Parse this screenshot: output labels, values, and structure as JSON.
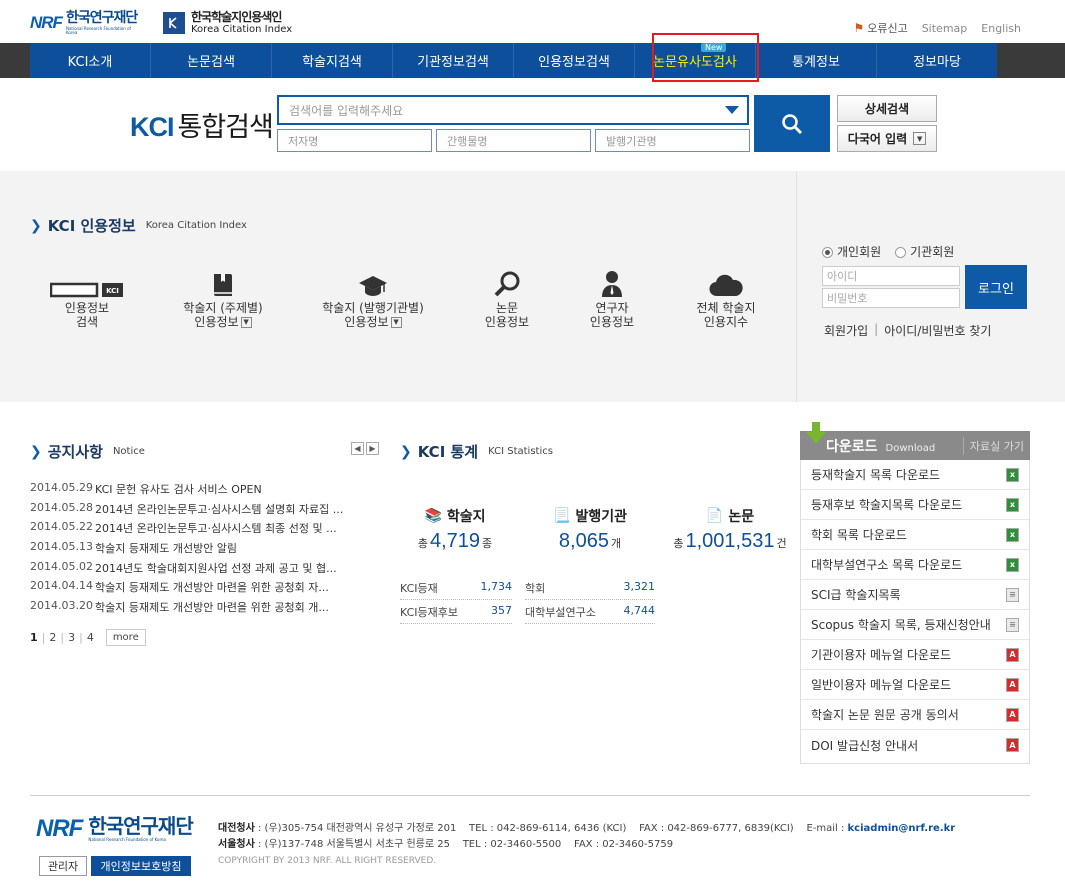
{
  "header": {
    "nrf_logo_mark": "NRF",
    "nrf_logo_kr": "한국연구재단",
    "nrf_logo_en": "National Research Foundation of Korea",
    "kci_logo_kr": "한국학술지인용색인",
    "kci_logo_en": "Korea Citation Index",
    "util": {
      "error_report": "오류신고",
      "sitemap": "Sitemap",
      "english": "English"
    }
  },
  "gnb": {
    "items": [
      "KCI소개",
      "논문검색",
      "학술지검색",
      "기관정보검색",
      "인용정보검색",
      "논문유사도검사",
      "통계정보",
      "정보마당"
    ],
    "new_badge": "New"
  },
  "search": {
    "title_bold": "KCI",
    "title": "통합검색",
    "main_placeholder": "검색어를 입력해주세요",
    "author_placeholder": "저자명",
    "journal_placeholder": "간행물명",
    "publisher_placeholder": "발행기관명",
    "detail_button": "상세검색",
    "multilang_button": "다국어 입력"
  },
  "citation": {
    "title": "KCI 인용정보",
    "subtitle": "Korea Citation Index",
    "items": [
      {
        "l1": "인용정보",
        "l2": "검색"
      },
      {
        "l1": "학술지 (주제별)",
        "l2": "인용정보"
      },
      {
        "l1": "학술지 (발행기관별)",
        "l2": "인용정보"
      },
      {
        "l1": "논문",
        "l2": "인용정보"
      },
      {
        "l1": "연구자",
        "l2": "인용정보"
      },
      {
        "l1": "전체 학술지",
        "l2": "인용지수"
      }
    ],
    "kci_tag": "KCI"
  },
  "login": {
    "radio_personal": "개인회원",
    "radio_institution": "기관회원",
    "id_placeholder": "아이디",
    "pw_placeholder": "비밀번호",
    "login_button": "로그인",
    "join": "회원가입",
    "find": "아이디/비밀번호 찾기"
  },
  "notice": {
    "title": "공지사항",
    "subtitle": "Notice",
    "rows": [
      {
        "date": "2014.05.29",
        "text": "KCI 문헌 유사도 검사 서비스 OPEN"
      },
      {
        "date": "2014.05.28",
        "text": "2014년 온라인논문투고·심사시스템 설명회 자료집 ..."
      },
      {
        "date": "2014.05.22",
        "text": "2014년 온라인논문투고·심사시스템 최종 선정 및 ..."
      },
      {
        "date": "2014.05.13",
        "text": "학술지 등재제도 개선방안 알림"
      },
      {
        "date": "2014.05.02",
        "text": "2014년도 학술대회지원사업 선정 과제 공고 및 협..."
      },
      {
        "date": "2014.04.14",
        "text": "학술지 등재제도 개선방안 마련을 위한 공청회 자..."
      },
      {
        "date": "2014.03.20",
        "text": "학술지 등재제도 개선방안 마련을 위한 공청회 개..."
      }
    ],
    "pages": [
      "1",
      "2",
      "3",
      "4"
    ],
    "more": "more"
  },
  "stats": {
    "title": "KCI 통계",
    "subtitle": "KCI Statistics",
    "journal": {
      "label": "학술지",
      "prefix": "총",
      "value": "4,719",
      "unit": "종"
    },
    "publisher": {
      "label": "발행기관",
      "value": "8,065",
      "unit": "개"
    },
    "paper": {
      "label": "논문",
      "prefix": "총",
      "value": "1,001,531",
      "unit": "건"
    },
    "rows": [
      {
        "name": "KCI등재",
        "value": "1,734"
      },
      {
        "name": "학회",
        "value": "3,321"
      },
      {
        "name": "KCI등재후보",
        "value": "357"
      },
      {
        "name": "대학부설연구소",
        "value": "4,744"
      }
    ]
  },
  "download": {
    "title": "다운로드",
    "subtitle": "Download",
    "go": "자료실 가기",
    "items": [
      {
        "label": "등재학술지 목록 다운로드",
        "icon": "xls"
      },
      {
        "label": "등재후보 학술지목록 다운로드",
        "icon": "xls"
      },
      {
        "label": "학회 목록 다운로드",
        "icon": "xls"
      },
      {
        "label": "대학부설연구소 목록 다운로드",
        "icon": "xls"
      },
      {
        "label": "SCI급 학술지목록",
        "icon": "doc"
      },
      {
        "label": "Scopus 학술지 목록, 등재신청안내",
        "icon": "doc"
      },
      {
        "label": "기관이용자 메뉴얼 다운로드",
        "icon": "pdf"
      },
      {
        "label": "일반이용자 메뉴얼 다운로드",
        "icon": "pdf"
      },
      {
        "label": "학술지 논문 원문 공개 동의서",
        "icon": "pdf"
      },
      {
        "label": "DOI 발급신청 안내서",
        "icon": "pdf"
      }
    ]
  },
  "footer": {
    "admin_button": "관리자",
    "privacy_button": "개인정보보호방침",
    "daejeon_label": "대전청사",
    "daejeon_addr": " : (우)305-754 대전광역시 유성구 가정로 201",
    "daejeon_tel": "TEL : 042-869-6114, 6436 (KCI)",
    "daejeon_fax": "FAX : 042-869-6777, 6839(KCI)",
    "email_label": "E-mail : ",
    "email": "kciadmin@nrf.re.kr",
    "seoul_label": "서울청사",
    "seoul_addr": " : (우)137-748 서울특별시 서초구 헌릉로 25",
    "seoul_tel": "TEL : 02-3460-5500",
    "seoul_fax": "FAX : 02-3460-5759",
    "copyright": "COPYRIGHT BY 2013 NRF. ALL RIGHT RESERVED."
  },
  "colors": {
    "brand_blue": "#0d4f9a",
    "highlight_yellow": "#fff200",
    "alert_red": "#e31b23"
  }
}
